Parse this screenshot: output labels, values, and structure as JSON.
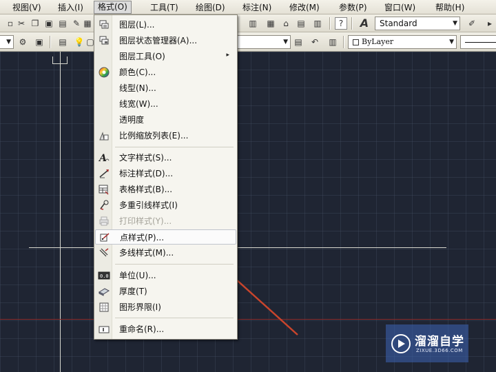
{
  "menubar": {
    "items": [
      "视图(V)",
      "插入(I)",
      "格式(O)",
      "工具(T)",
      "绘图(D)",
      "标注(N)",
      "修改(M)",
      "参数(P)",
      "窗口(W)",
      "帮助(H)"
    ]
  },
  "toolbar": {
    "text_style": "Standard",
    "color_control": "ByLayer"
  },
  "format_menu": {
    "items": [
      {
        "label": "图层(L)...",
        "icon": "layer-icon"
      },
      {
        "label": "图层状态管理器(A)...",
        "icon": "layer-state-icon"
      },
      {
        "label": "图层工具(O)",
        "icon": "",
        "submenu_arrow": "▸"
      },
      {
        "label": "颜色(C)...",
        "icon": "color-wheel-icon"
      },
      {
        "label": "线型(N)...",
        "icon": ""
      },
      {
        "label": "线宽(W)...",
        "icon": ""
      },
      {
        "label": "透明度",
        "icon": ""
      },
      {
        "label": "比例缩放列表(E)...",
        "icon": "scale-list-icon"
      },
      {
        "label": "文字样式(S)...",
        "icon": "text-style-icon"
      },
      {
        "label": "标注样式(D)...",
        "icon": "dimension-style-icon"
      },
      {
        "label": "表格样式(B)...",
        "icon": "table-style-icon"
      },
      {
        "label": "多重引线样式(I)",
        "icon": "multileader-style-icon"
      },
      {
        "label": "打印样式(Y)...",
        "icon": "plot-style-icon",
        "disabled": true
      },
      {
        "label": "点样式(P)...",
        "icon": "point-style-icon",
        "highlighted": true
      },
      {
        "label": "多线样式(M)...",
        "icon": "multiline-style-icon"
      },
      {
        "label": "单位(U)...",
        "icon": "units-icon"
      },
      {
        "label": "厚度(T)",
        "icon": "thickness-icon"
      },
      {
        "label": "图形界限(I)",
        "icon": "drawing-limits-icon"
      },
      {
        "label": "重命名(R)...",
        "icon": "rename-icon"
      }
    ]
  },
  "watermark": {
    "title": "溜溜自学",
    "url": "ZIXUE.3D66.COM"
  },
  "colors": {
    "canvas_bg": "#1f2533",
    "annotation_arrow": "#c9452c",
    "crosshair": "#d8d8d0",
    "red_axis": "#8a2b2b"
  }
}
